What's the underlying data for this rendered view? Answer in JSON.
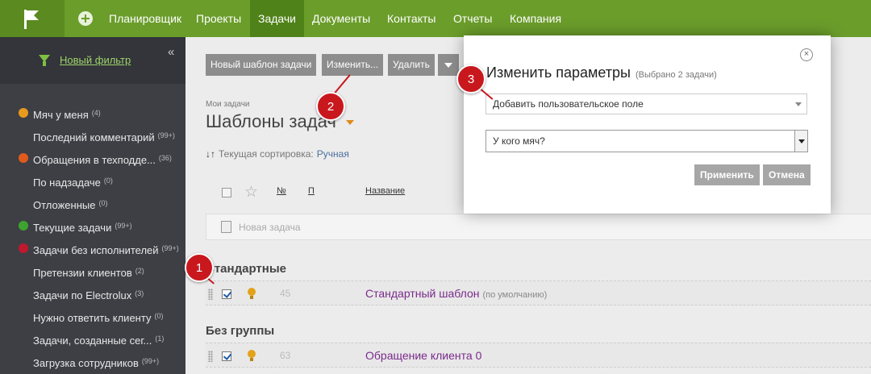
{
  "nav": {
    "items": [
      "Планировщик",
      "Проекты",
      "Задачи",
      "Документы",
      "Контакты",
      "Отчеты",
      "Компания"
    ],
    "active": "Задачи"
  },
  "sidebar": {
    "filter_label": "Новый фильтр",
    "collapse_glyph": "«",
    "items": [
      {
        "label": "Мяч у меня",
        "count": "(4)",
        "dot": "#e89a1c"
      },
      {
        "label": "Последний комментарий",
        "count": "(99+)",
        "dot": ""
      },
      {
        "label": "Обращения в техподде...",
        "count": "(36)",
        "dot": "#e05a1e"
      },
      {
        "label": "По надзадаче",
        "count": "(0)",
        "dot": ""
      },
      {
        "label": "Отложенные",
        "count": "(0)",
        "dot": ""
      },
      {
        "label": "Текущие задачи",
        "count": "(99+)",
        "dot": "#3da32e"
      },
      {
        "label": "Задачи без исполнителей",
        "count": "(99+)",
        "dot": "#c0182e"
      },
      {
        "label": "Претензии клиентов",
        "count": "(2)",
        "dot": ""
      },
      {
        "label": "Задачи по Electrolux",
        "count": "(3)",
        "dot": ""
      },
      {
        "label": "Нужно ответить клиенту",
        "count": "(0)",
        "dot": ""
      },
      {
        "label": "Задачи, созданные сег...",
        "count": "(1)",
        "dot": ""
      },
      {
        "label": "Загрузка сотрудников",
        "count": "(99+)",
        "dot": ""
      }
    ]
  },
  "toolbar": {
    "new_template": "Новый шаблон задачи",
    "edit": "Изменить...",
    "delete": "Удалить"
  },
  "page": {
    "breadcrumb": "Мои задачи",
    "title": "Шаблоны задач",
    "sort_label": "Текущая сортировка:",
    "sort_value": "Ручная"
  },
  "table": {
    "columns": [
      "№",
      "П",
      "Название"
    ],
    "new_task_placeholder": "Новая задача"
  },
  "groups": [
    {
      "title": "Стандартные",
      "rows": [
        {
          "num": "45",
          "name": "Стандартный шаблон",
          "note": "(по умолчанию)"
        }
      ]
    },
    {
      "title": "Без группы",
      "rows": [
        {
          "num": "63",
          "name": "Обращение клиента 0",
          "note": ""
        }
      ]
    }
  ],
  "badges": [
    "1",
    "2",
    "3"
  ],
  "modal": {
    "title": "Изменить параметры",
    "subtitle": "(Выбрано 2 задачи)",
    "select1": "Добавить пользовательское поле",
    "select2": "У кого мяч?",
    "apply": "Применить",
    "cancel": "Отмена",
    "close_glyph": "×"
  }
}
